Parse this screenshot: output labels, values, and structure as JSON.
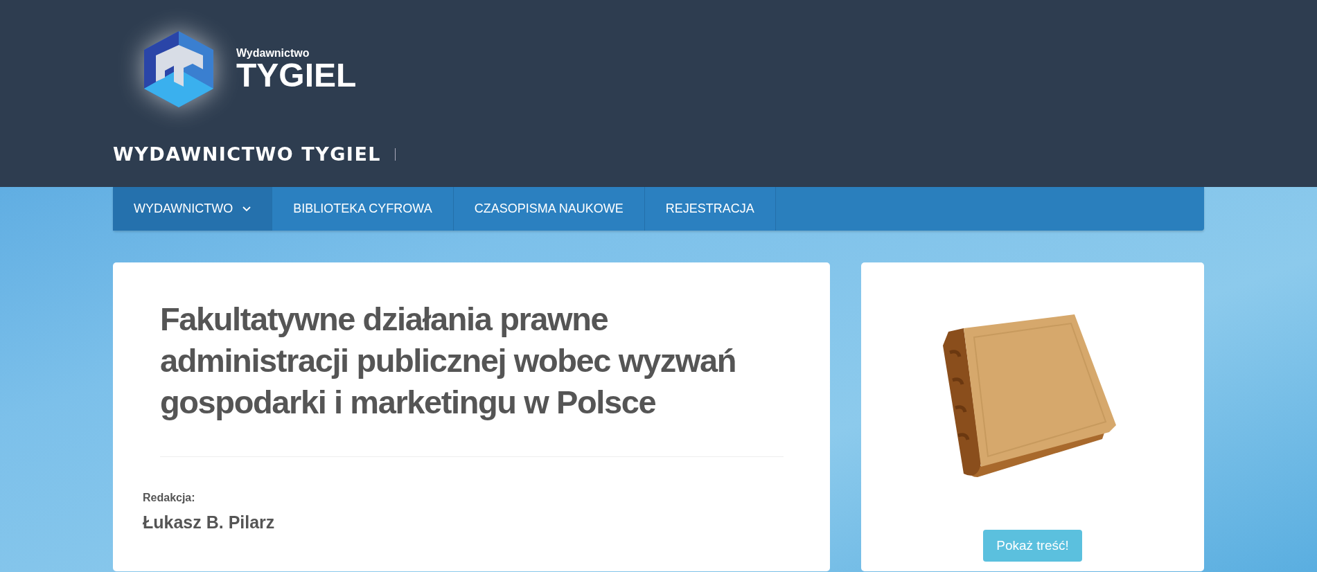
{
  "logo": {
    "small": "Wydawnictwo",
    "big": "TYGIEL"
  },
  "site_title": "WYDAWNICTWO TYGIEL",
  "nav": [
    {
      "label": "WYDAWNICTWO",
      "dropdown": true,
      "selected": true
    },
    {
      "label": "BIBLIOTEKA CYFROWA",
      "dropdown": false,
      "selected": false
    },
    {
      "label": "CZASOPISMA NAUKOWE",
      "dropdown": false,
      "selected": false
    },
    {
      "label": "REJESTRACJA",
      "dropdown": false,
      "selected": false
    }
  ],
  "article": {
    "title": "Fakultatywne działania prawne administracji publicznej wobec wyzwań gospodarki i marketingu w Polsce",
    "editor_label": "Redakcja:",
    "editor": "Łukasz B. Pilarz"
  },
  "sidebar": {
    "button": "Pokaż treść!"
  }
}
